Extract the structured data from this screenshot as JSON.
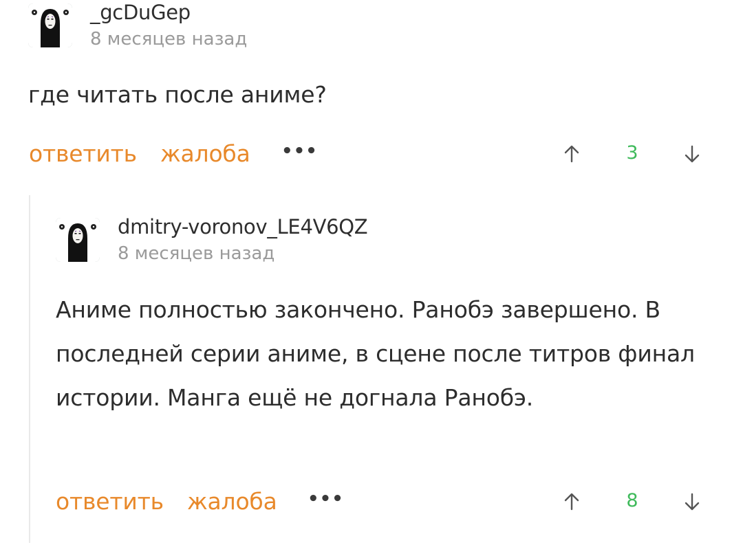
{
  "comments": [
    {
      "username": "_gcDuGep",
      "time": "8 месяцев назад",
      "text": "где читать после аниме?",
      "actions": {
        "reply": "ответить",
        "report": "жалоба",
        "more": "•••"
      },
      "rating": "3"
    },
    {
      "username": "dmitry-voronov_LE4V6QZ",
      "time": "8 месяцев назад",
      "text": "Аниме полностью закончено. Ранобэ завершено. В последней серии аниме, в сцене после титров финал истории. Манга ещё не догнала Ранобэ.",
      "actions": {
        "reply": "ответить",
        "report": "жалоба",
        "more": "•••"
      },
      "rating": "8"
    }
  ],
  "colors": {
    "action": "#e8892b",
    "rating_positive": "#3fba5b",
    "avatar_bg": "#7e8c87"
  }
}
